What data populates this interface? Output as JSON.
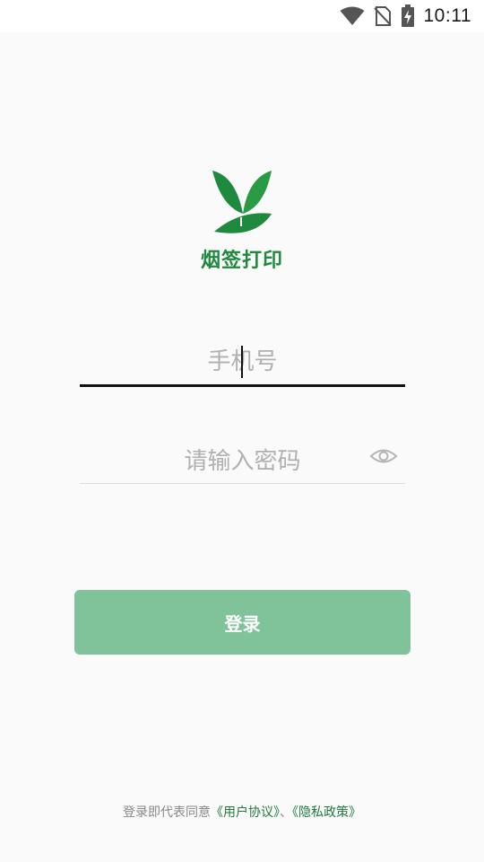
{
  "status_bar": {
    "time": "10:11",
    "icons": [
      "wifi-icon",
      "no-sim-icon",
      "battery-charging-icon"
    ]
  },
  "logo": {
    "icon": "leaf-y-logo",
    "text": "烟签打印",
    "color": "#1f8a3e"
  },
  "login_form": {
    "phone_placeholder": "手机号",
    "password_placeholder": "请输入密码",
    "password_toggle_icon": "eye-icon",
    "login_button_label": "登录",
    "button_color": "#80c39a"
  },
  "footer": {
    "prefix": "登录即代表同意",
    "user_agreement": "《用户协议》",
    "separator": "、",
    "privacy_policy": "《隐私政策》"
  }
}
